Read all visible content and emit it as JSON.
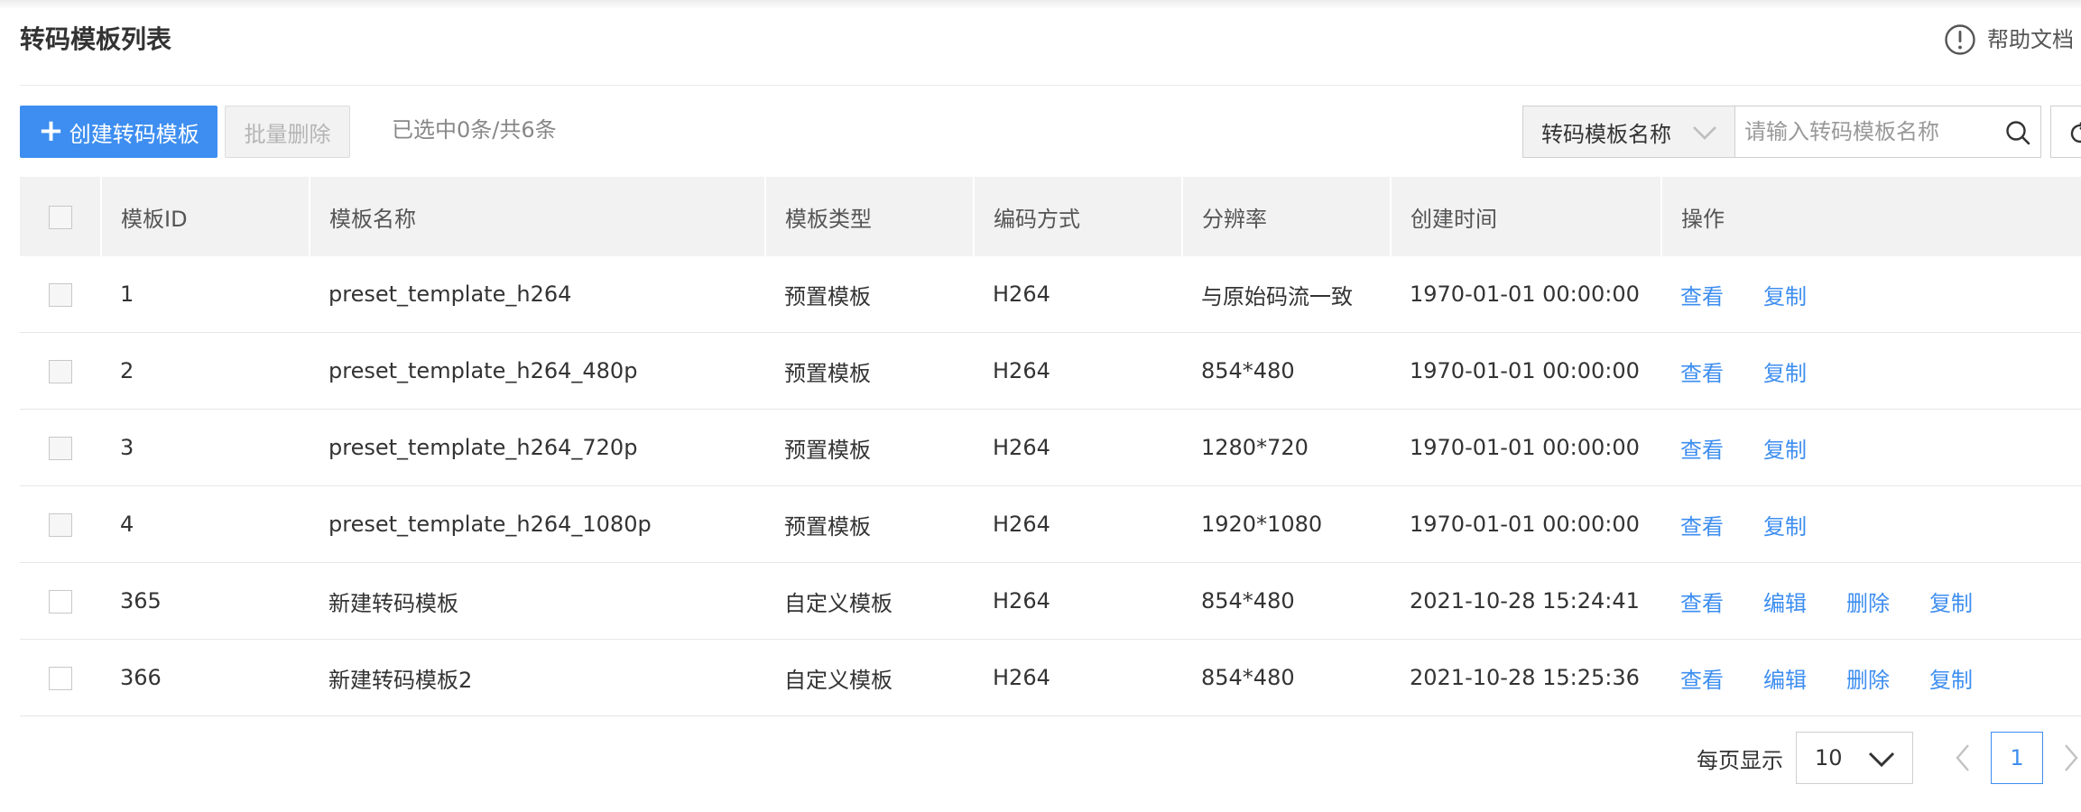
{
  "header": {
    "title": "转码模板列表",
    "help_label": "帮助文档"
  },
  "toolbar": {
    "create_label": "创建转码模板",
    "batch_delete_label": "批量删除",
    "selected_info": "已选中0条/共6条",
    "search_field_label": "转码模板名称",
    "search_placeholder": "请输入转码模板名称"
  },
  "table": {
    "columns": [
      "模板ID",
      "模板名称",
      "模板类型",
      "编码方式",
      "分辨率",
      "创建时间",
      "操作"
    ],
    "rows": [
      {
        "id": "1",
        "name": "preset_template_h264",
        "type": "预置模板",
        "codec": "H264",
        "resolution": "与原始码流一致",
        "created": "1970-01-01 00:00:00",
        "actions": [
          "查看",
          "复制"
        ]
      },
      {
        "id": "2",
        "name": "preset_template_h264_480p",
        "type": "预置模板",
        "codec": "H264",
        "resolution": "854*480",
        "created": "1970-01-01 00:00:00",
        "actions": [
          "查看",
          "复制"
        ]
      },
      {
        "id": "3",
        "name": "preset_template_h264_720p",
        "type": "预置模板",
        "codec": "H264",
        "resolution": "1280*720",
        "created": "1970-01-01 00:00:00",
        "actions": [
          "查看",
          "复制"
        ]
      },
      {
        "id": "4",
        "name": "preset_template_h264_1080p",
        "type": "预置模板",
        "codec": "H264",
        "resolution": "1920*1080",
        "created": "1970-01-01 00:00:00",
        "actions": [
          "查看",
          "复制"
        ]
      },
      {
        "id": "365",
        "name": "新建转码模板",
        "type": "自定义模板",
        "codec": "H264",
        "resolution": "854*480",
        "created": "2021-10-28 15:24:41",
        "actions": [
          "查看",
          "编辑",
          "删除",
          "复制"
        ]
      },
      {
        "id": "366",
        "name": "新建转码模板2",
        "type": "自定义模板",
        "codec": "H264",
        "resolution": "854*480",
        "created": "2021-10-28 15:25:36",
        "actions": [
          "查看",
          "编辑",
          "删除",
          "复制"
        ]
      }
    ]
  },
  "pagination": {
    "per_page_label": "每页显示",
    "per_page_value": "10",
    "current_page": "1"
  },
  "colors": {
    "accent": "#3d8ef0",
    "header_bg": "#f2f2f2"
  }
}
